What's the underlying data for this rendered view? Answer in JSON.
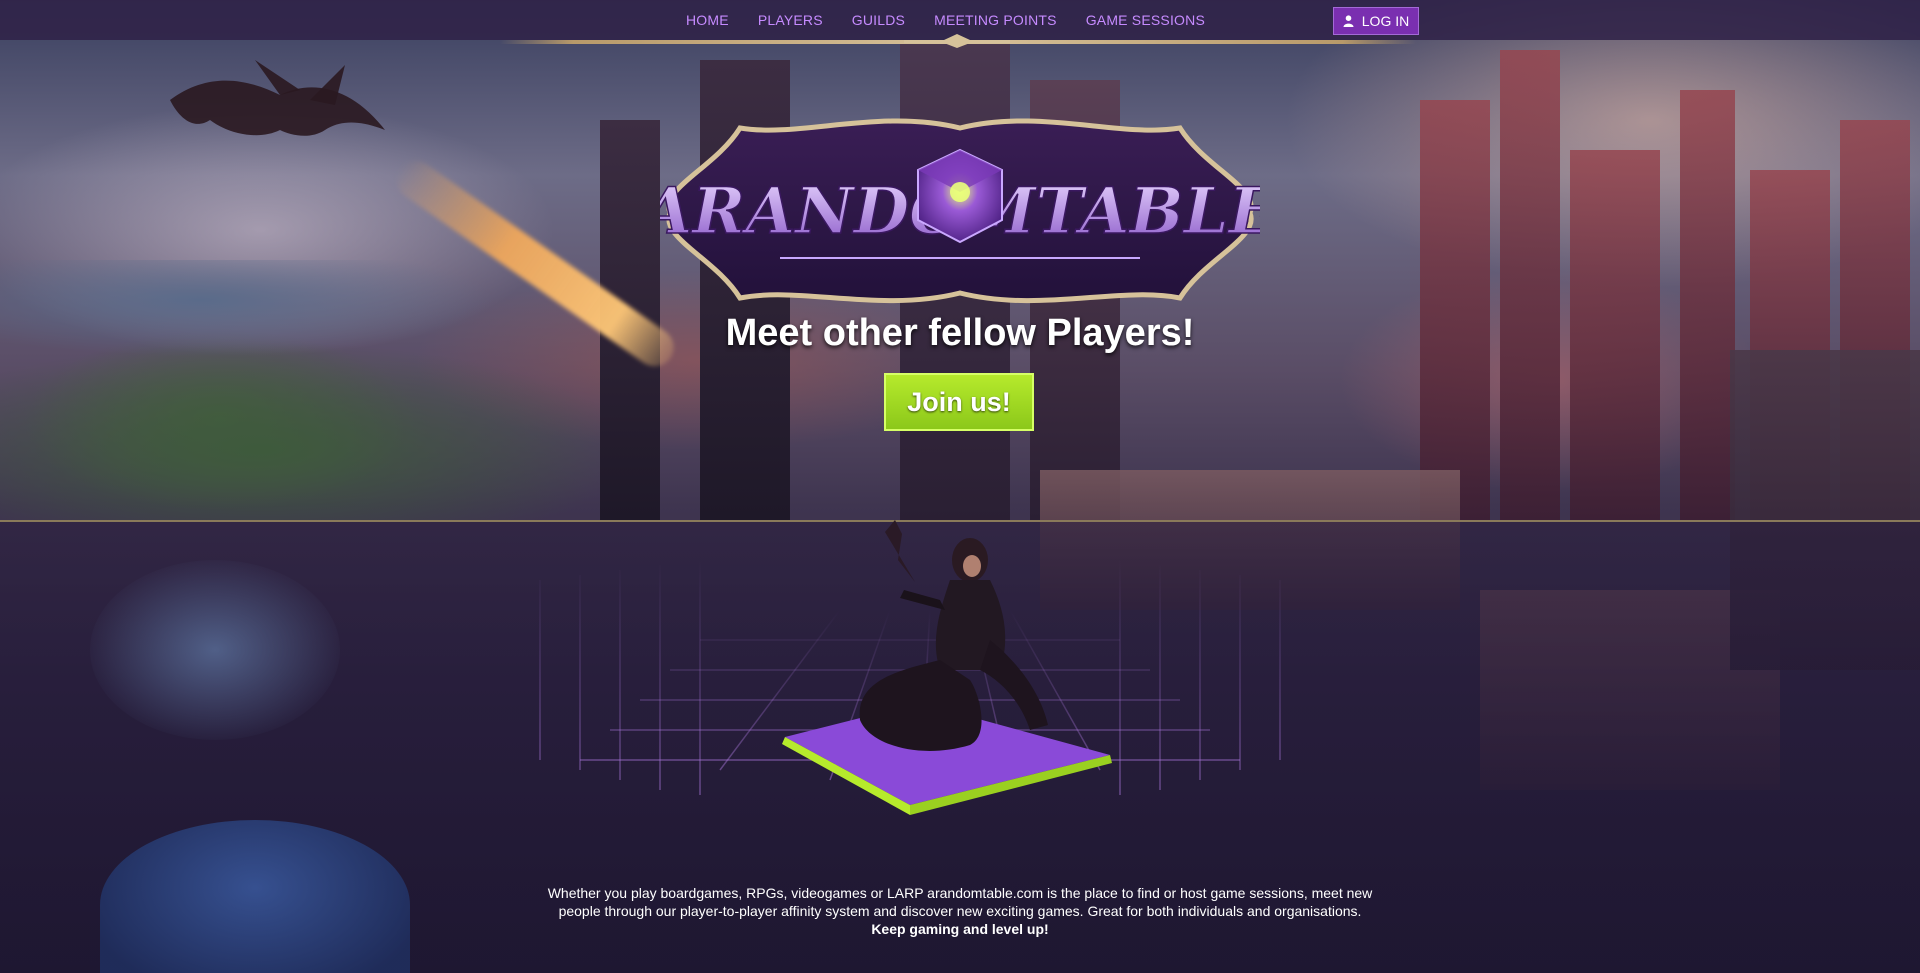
{
  "nav": {
    "items": [
      {
        "label": "HOME"
      },
      {
        "label": "PLAYERS"
      },
      {
        "label": "GUILDS"
      },
      {
        "label": "MEETING POINTS"
      },
      {
        "label": "GAME SESSIONS"
      }
    ],
    "login_label": "LOG IN",
    "login_icon": "user-icon"
  },
  "hero": {
    "logo_text": "ARANDOMTABLE",
    "tagline": "Meet other fellow Players!",
    "cta_label": "Join us!"
  },
  "intro": {
    "text": "Whether you play boardgames, RPGs, videogames or LARP arandomtable.com is the place to find or host game sessions, meet new people through our player-to-player affinity system and discover new exciting games. Great for both individuals and organisations.",
    "emphasis": "Keep gaming and level up!"
  },
  "colors": {
    "nav_link": "#c68bff",
    "login_bg": "#7a2fb0",
    "cta_bg": "#9fd822",
    "logo_purple": "#5a2a8a",
    "gold_trim": "#d6c29a"
  }
}
